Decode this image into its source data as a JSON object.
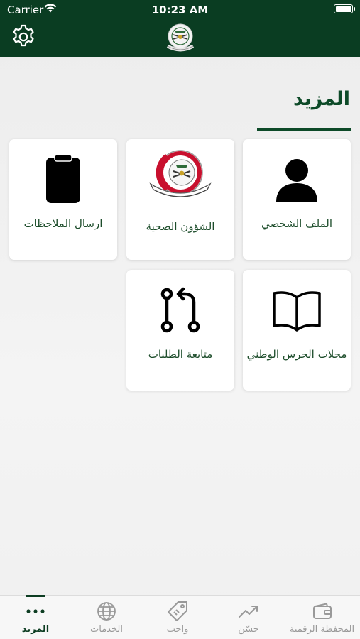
{
  "status_bar": {
    "carrier": "Carrier",
    "time": "10:23 AM"
  },
  "header": {
    "title": "المزيد"
  },
  "tiles": [
    {
      "label": "الملف الشخصي",
      "icon": "person-icon"
    },
    {
      "label": "الشؤون الصحية",
      "icon": "health-affairs-emblem-icon"
    },
    {
      "label": "ارسال الملاحظات",
      "icon": "clipboard-icon"
    },
    {
      "label": "مجلات الحرس الوطني",
      "icon": "open-book-icon"
    },
    {
      "label": "متابعة الطلبات",
      "icon": "git-compare-icon"
    }
  ],
  "tabbar": {
    "items": [
      {
        "label": "المحفظة الرقمية",
        "icon": "wallet-icon",
        "active": false
      },
      {
        "label": "حسّن",
        "icon": "trending-up-icon",
        "active": false
      },
      {
        "label": "واجب",
        "icon": "tag-icon",
        "active": false
      },
      {
        "label": "الخدمات",
        "icon": "globe-icon",
        "active": false
      },
      {
        "label": "المزيد",
        "icon": "more-dots-icon",
        "active": true
      }
    ]
  },
  "colors": {
    "primary": "#0a3d22",
    "accent_text": "#0d4a28",
    "tab_inactive": "#999999",
    "health_red": "#c8102e"
  }
}
